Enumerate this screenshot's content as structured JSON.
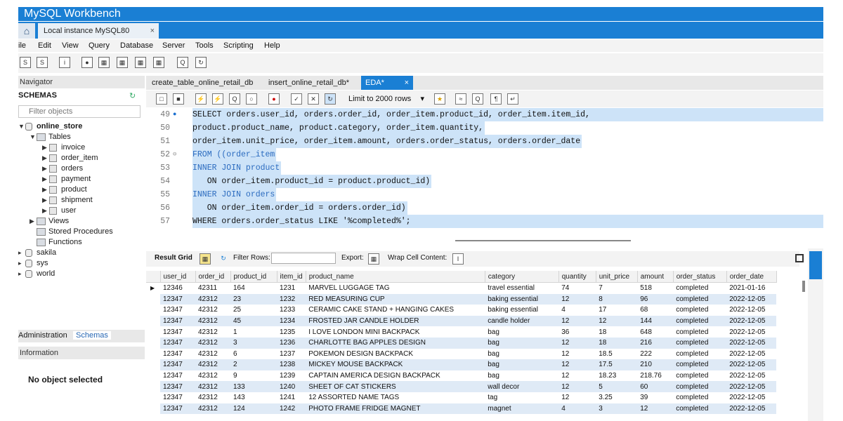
{
  "window": {
    "title": "MySQL Workbench"
  },
  "connection_tab": {
    "label": "Local instance MySQL80",
    "close": "×"
  },
  "menu": [
    "ile",
    "Edit",
    "View",
    "Query",
    "Database",
    "Server",
    "Tools",
    "Scripting",
    "Help"
  ],
  "navigator": {
    "header": "Navigator",
    "schemas_title": "SCHEMAS",
    "filter_placeholder": "Filter objects",
    "tree": {
      "schema": "online_store",
      "tables_label": "Tables",
      "tables": [
        "invoice",
        "order_item",
        "orders",
        "payment",
        "product",
        "shipment",
        "user"
      ],
      "views_label": "Views",
      "stored_procedures_label": "Stored Procedures",
      "functions_label": "Functions",
      "other_schemas": [
        "sakila",
        "sys",
        "world"
      ]
    },
    "tabs": [
      "Administration",
      "Schemas"
    ],
    "information_header": "Information",
    "info_text": "No object selected"
  },
  "editor_tabs": [
    {
      "label": "create_table_online_retail_db"
    },
    {
      "label": "insert_online_retail_db*"
    },
    {
      "label": "EDA*",
      "close": "×"
    }
  ],
  "query_toolbar": {
    "limit_label": "Limit to 2000 rows"
  },
  "code_lines": [
    {
      "no": "49",
      "text": "SELECT orders.user_id, orders.order_id, order_item.product_id, order_item.item_id,"
    },
    {
      "no": "50",
      "text": "product.product_name, product.category, order_item.quantity,"
    },
    {
      "no": "51",
      "text": "order_item.unit_price, order_item.amount, orders.order_status, orders.order_date"
    },
    {
      "no": "52",
      "text": "FROM ((order_item"
    },
    {
      "no": "53",
      "text": "INNER JOIN product"
    },
    {
      "no": "54",
      "text": "   ON order_item.product_id = product.product_id)"
    },
    {
      "no": "55",
      "text": "INNER JOIN orders"
    },
    {
      "no": "56",
      "text": "   ON order_item.order_id = orders.order_id)"
    },
    {
      "no": "57",
      "text": "WHERE orders.order_status LIKE '%completed%';"
    }
  ],
  "result_toolbar": {
    "result_grid": "Result Grid",
    "filter_rows": "Filter Rows:",
    "export": "Export:",
    "wrap": "Wrap Cell Content:"
  },
  "grid": {
    "columns": [
      "user_id",
      "order_id",
      "product_id",
      "item_id",
      "product_name",
      "category",
      "quantity",
      "unit_price",
      "amount",
      "order_status",
      "order_date"
    ],
    "rows": [
      [
        "12346",
        "42311",
        "164",
        "1231",
        "MARVEL LUGGAGE TAG",
        "travel essential",
        "74",
        "7",
        "518",
        "completed",
        "2021-01-16"
      ],
      [
        "12347",
        "42312",
        "23",
        "1232",
        "RED MEASURING CUP",
        "baking essential",
        "12",
        "8",
        "96",
        "completed",
        "2022-12-05"
      ],
      [
        "12347",
        "42312",
        "25",
        "1233",
        "CERAMIC CAKE STAND + HANGING CAKES",
        "baking essential",
        "4",
        "17",
        "68",
        "completed",
        "2022-12-05"
      ],
      [
        "12347",
        "42312",
        "45",
        "1234",
        "FROSTED JAR CANDLE HOLDER",
        "candle holder",
        "12",
        "12",
        "144",
        "completed",
        "2022-12-05"
      ],
      [
        "12347",
        "42312",
        "1",
        "1235",
        " I LOVE LONDON MINI BACKPACK",
        "bag",
        "36",
        "18",
        "648",
        "completed",
        "2022-12-05"
      ],
      [
        "12347",
        "42312",
        "3",
        "1236",
        "CHARLOTTE BAG APPLES DESIGN",
        "bag",
        "12",
        "18",
        "216",
        "completed",
        "2022-12-05"
      ],
      [
        "12347",
        "42312",
        "6",
        "1237",
        "POKEMON DESIGN BACKPACK",
        "bag",
        "12",
        "18.5",
        "222",
        "completed",
        "2022-12-05"
      ],
      [
        "12347",
        "42312",
        "2",
        "1238",
        " MICKEY MOUSE BACKPACK",
        "bag",
        "12",
        "17.5",
        "210",
        "completed",
        "2022-12-05"
      ],
      [
        "12347",
        "42312",
        "9",
        "1239",
        "CAPTAIN AMERICA DESIGN BACKPACK",
        "bag",
        "12",
        "18.23",
        "218.76",
        "completed",
        "2022-12-05"
      ],
      [
        "12347",
        "42312",
        "133",
        "1240",
        "SHEET OF CAT STICKERS",
        "wall decor",
        "12",
        "5",
        "60",
        "completed",
        "2022-12-05"
      ],
      [
        "12347",
        "42312",
        "143",
        "1241",
        "12 ASSORTED NAME TAGS",
        "tag",
        "12",
        "3.25",
        "39",
        "completed",
        "2022-12-05"
      ],
      [
        "12347",
        "42312",
        "124",
        "1242",
        "PHOTO FRAME FRIDGE MAGNET",
        "magnet",
        "4",
        "3",
        "12",
        "completed",
        "2022-12-05"
      ]
    ]
  },
  "colors": {
    "accent": "#1a7fd4",
    "row_alt": "#dfeaf6",
    "selection": "#cde3f8"
  }
}
